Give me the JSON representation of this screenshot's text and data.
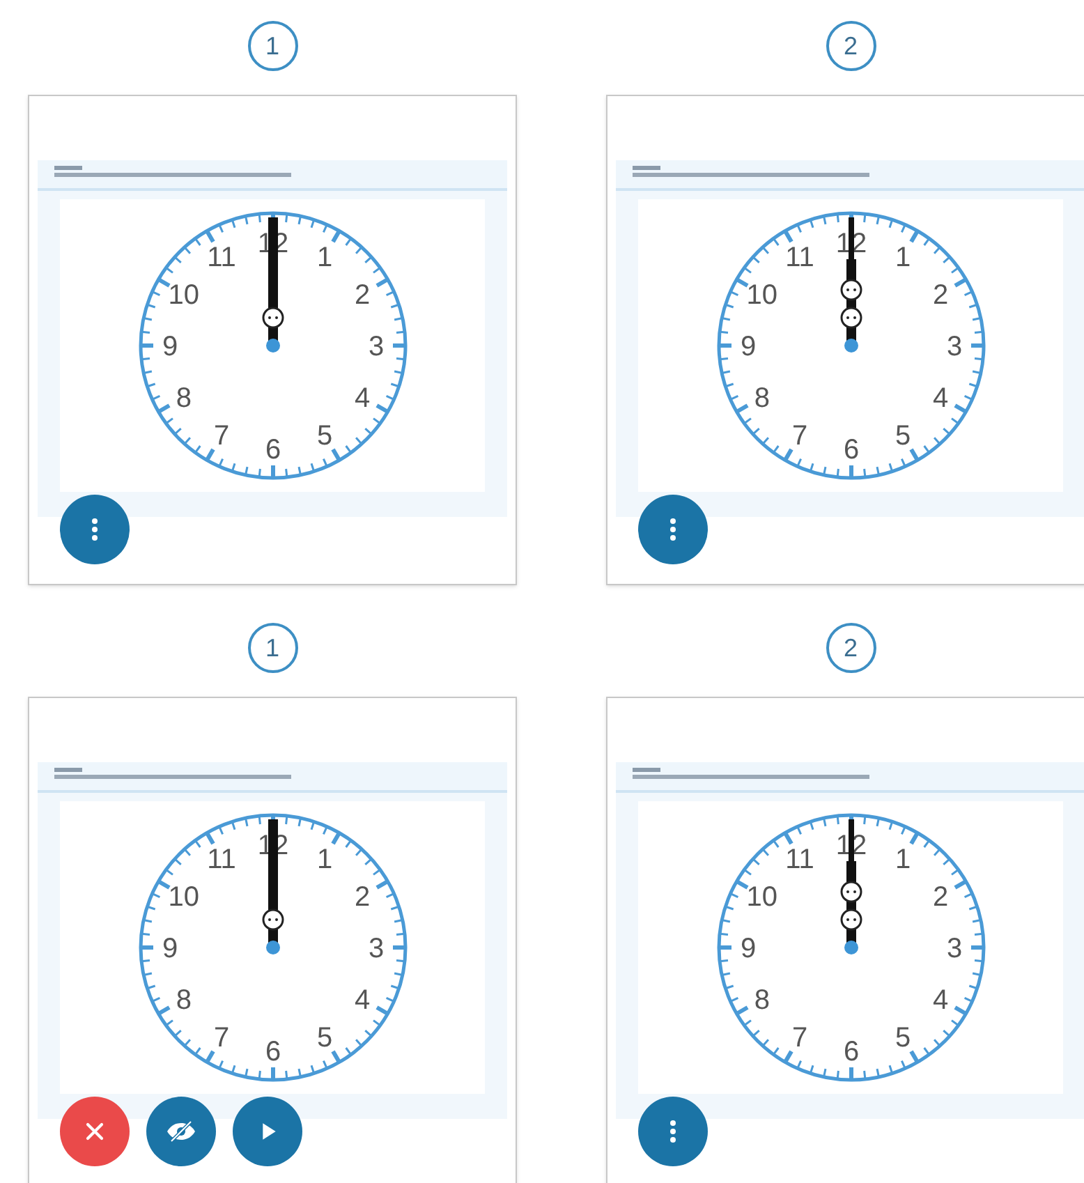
{
  "panels": [
    {
      "number": "1",
      "clock": {
        "hands_merged": true,
        "numbers": [
          "12",
          "11",
          "1",
          "10",
          "2",
          "9",
          "3",
          "8",
          "4",
          "7",
          "5",
          "6"
        ]
      },
      "buttons": [
        {
          "kind": "menu"
        }
      ]
    },
    {
      "number": "2",
      "clock": {
        "hands_merged": false,
        "numbers": [
          "12",
          "11",
          "1",
          "10",
          "2",
          "9",
          "3",
          "8",
          "4",
          "7",
          "5",
          "6"
        ]
      },
      "buttons": [
        {
          "kind": "menu"
        }
      ]
    },
    {
      "number": "1",
      "clock": {
        "hands_merged": true,
        "numbers": [
          "12",
          "11",
          "1",
          "10",
          "2",
          "9",
          "3",
          "8",
          "4",
          "7",
          "5",
          "6"
        ]
      },
      "buttons": [
        {
          "kind": "close"
        },
        {
          "kind": "hide"
        },
        {
          "kind": "play"
        }
      ]
    },
    {
      "number": "2",
      "clock": {
        "hands_merged": false,
        "numbers": [
          "12",
          "11",
          "1",
          "10",
          "2",
          "9",
          "3",
          "8",
          "4",
          "7",
          "5",
          "6"
        ]
      },
      "buttons": [
        {
          "kind": "menu"
        }
      ]
    }
  ]
}
